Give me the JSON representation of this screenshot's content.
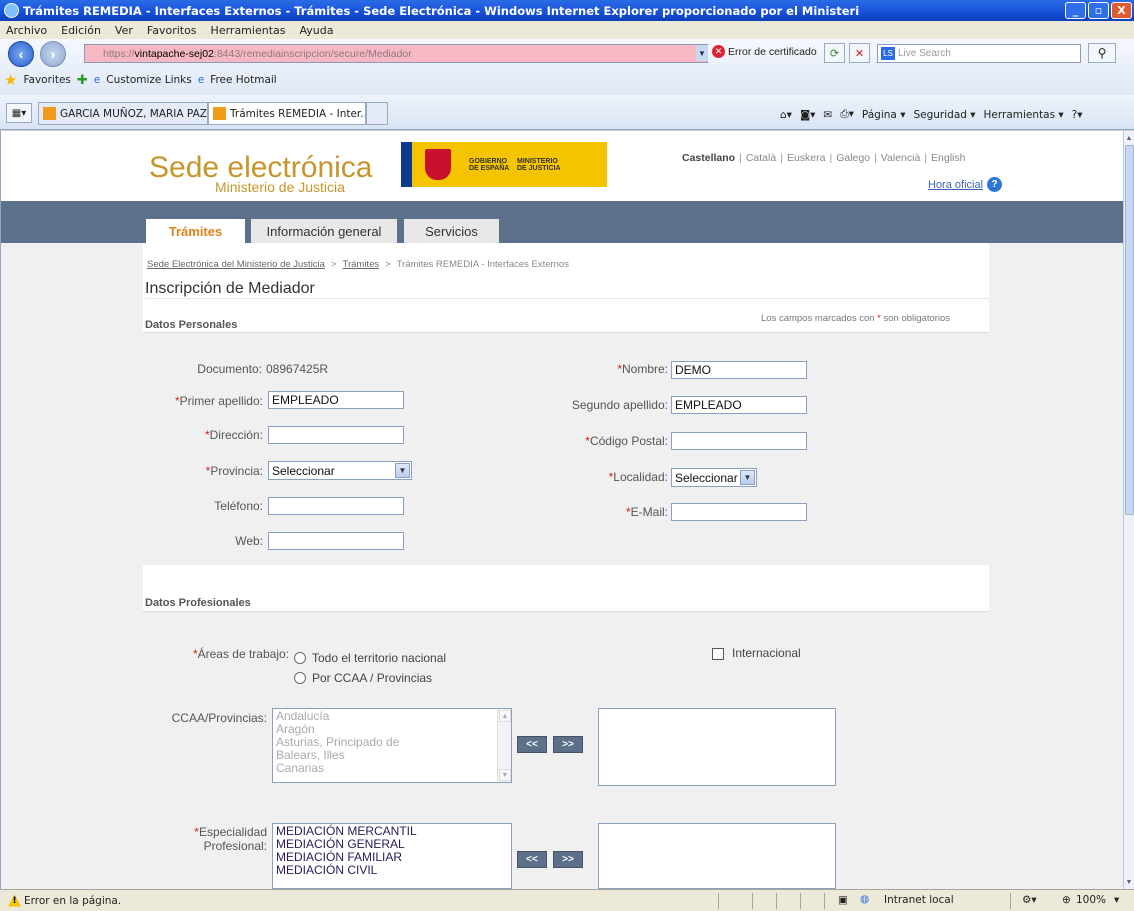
{
  "window": {
    "title": "Trámites REMEDIA - Interfaces Externos - Trámites - Sede Electrónica - Windows Internet Explorer proporcionado por el Ministeri",
    "min": "_",
    "max": "▫",
    "close": "X"
  },
  "menu": [
    "Archivo",
    "Edición",
    "Ver",
    "Favoritos",
    "Herramientas",
    "Ayuda"
  ],
  "address": {
    "scheme": "https://",
    "host": "vintapache-sej02",
    "rest": ":8443/remediainscripcion/secure/Mediador",
    "cert_error": "Error de certificado",
    "search_placeholder": "Live Search"
  },
  "favorites": {
    "label": "Favorites",
    "links": [
      "Customize Links",
      "Free Hotmail"
    ]
  },
  "browser_tabs": [
    {
      "label": "GARCIA MUÑOZ, MARIA PAZ..."
    },
    {
      "label": "Trámites REMEDIA - Inter..."
    }
  ],
  "commands": [
    "Página ▾",
    "Seguridad ▾",
    "Herramientas ▾"
  ],
  "header": {
    "title": "Sede electrónica",
    "subtitle": "Ministerio de Justicia",
    "logo_text_1": "GOBIERNO\nDE ESPAÑA",
    "logo_text_2": "MINISTERIO\nDE JUSTICIA",
    "languages": [
      "Castellano",
      "Català",
      "Euskera",
      "Galego",
      "Valencià",
      "English"
    ],
    "hora_oficial": "Hora oficial"
  },
  "nav": {
    "tabs": [
      {
        "label": "Trámites",
        "active": true
      },
      {
        "label": "Información general",
        "active": false
      },
      {
        "label": "Servicios",
        "active": false
      }
    ]
  },
  "breadcrumb": {
    "items": [
      "Sede Electrónica del Ministerio de Justicia",
      "Trámites",
      "Trámites REMEDIA - Interfaces Externos"
    ]
  },
  "page_title": "Inscripción de Mediador",
  "required_note": {
    "before": "Los campos marcados con ",
    "mark": "*",
    "after": " son obligatorios"
  },
  "personal": {
    "section_title": "Datos Personales",
    "documento_label": "Documento:",
    "documento_value": "08967425R",
    "nombre_label": "Nombre:",
    "nombre_value": "DEMO",
    "apellido1_label": "Primer apellido:",
    "apellido1_value": "EMPLEADO",
    "apellido2_label": "Segundo apellido:",
    "apellido2_value": "EMPLEADO",
    "direccion_label": "Dirección:",
    "direccion_value": "",
    "cp_label": "Código Postal:",
    "cp_value": "",
    "provincia_label": "Provincia:",
    "provincia_value": "Seleccionar",
    "localidad_label": "Localidad:",
    "localidad_value": "Seleccionar",
    "telefono_label": "Teléfono:",
    "telefono_value": "",
    "email_label": "E-Mail:",
    "email_value": "",
    "web_label": "Web:",
    "web_value": ""
  },
  "professional": {
    "section_title": "Datos Profesionales",
    "areas_label": "Áreas de trabajo:",
    "opt_nacional": "Todo el territorio nacional",
    "opt_ccaa": "Por CCAA / Provincias",
    "internacional": "Internacional",
    "ccaa_label": "CCAA/Provincias:",
    "ccaa_items": [
      "Andalucía",
      "Aragón",
      "Asturias, Principado de",
      "Balears, Illes",
      "Canarias"
    ],
    "especialidad_label_1": "Especialidad",
    "especialidad_label_2": "Profesional:",
    "especialidad_items": [
      "MEDIACIÓN MERCANTIL",
      "MEDIACIÓN GENERAL",
      "MEDIACIÓN FAMILIAR",
      "MEDIACIÓN CIVIL"
    ],
    "btn_remove": "<<",
    "btn_add": ">>"
  },
  "status": {
    "message": "Error en la página.",
    "zone": "Intranet local",
    "zoom": "100%"
  },
  "colors": {
    "brand_gold": "#c6952b",
    "nav_band": "#5c7189",
    "active_tab": "#e2821a",
    "required": "#d82020"
  }
}
